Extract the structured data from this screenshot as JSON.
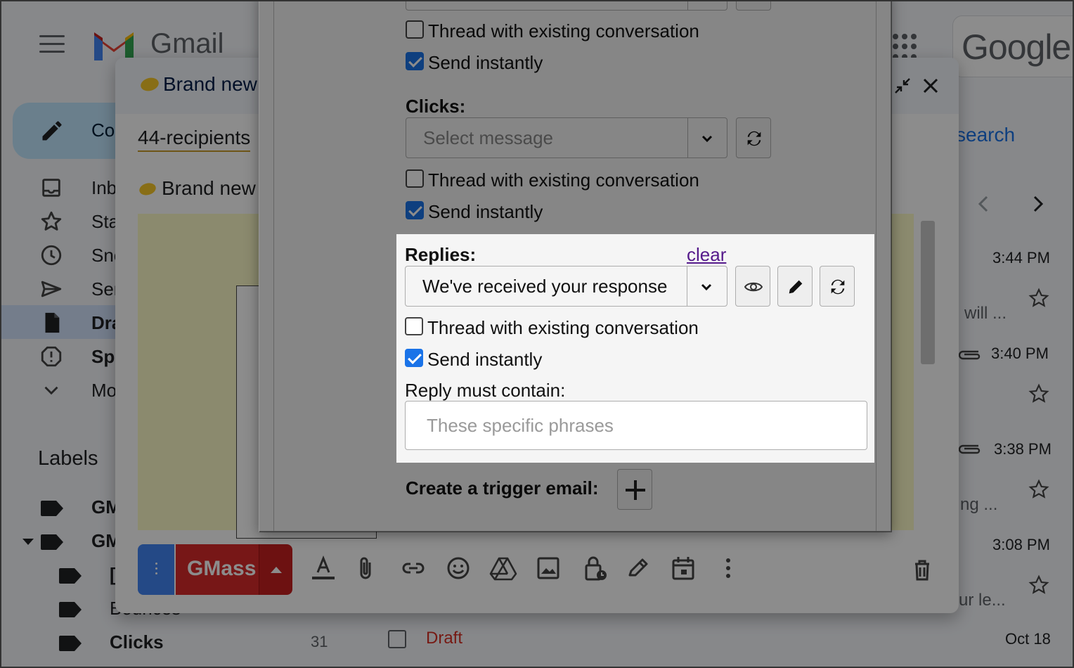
{
  "gmail": {
    "wordmark": "Gmail",
    "google_text": "Google",
    "compose_label": "Compose",
    "nav": [
      {
        "label": "Inbox",
        "icon": "inbox-icon"
      },
      {
        "label": "Starred",
        "icon": "star-icon"
      },
      {
        "label": "Snoozed",
        "icon": "clock-icon"
      },
      {
        "label": "Sent",
        "icon": "send-icon"
      },
      {
        "label": "Drafts",
        "icon": "draft-icon"
      },
      {
        "label": "Spam",
        "icon": "spam-icon"
      },
      {
        "label": "More",
        "icon": "chevron-down-icon"
      }
    ],
    "labels_heading": "Labels",
    "labels": [
      {
        "text": "GMass"
      },
      {
        "text": "GMass Reports"
      },
      {
        "text": "[..."
      },
      {
        "text": "Bounces"
      },
      {
        "text": "Clicks",
        "count": "31"
      }
    ],
    "search_link": "search",
    "mail_list": [
      {
        "time": "3:44 PM",
        "snippet": "will ..."
      },
      {
        "time": "3:40 PM",
        "snippet": ""
      },
      {
        "time": "3:38 PM",
        "snippet": "ng ..."
      },
      {
        "time": "3:08 PM",
        "snippet": "ur le..."
      }
    ],
    "draft_label": "Draft",
    "draft_date": "Oct 18"
  },
  "compose": {
    "title": "Brand new",
    "to": "44-recipients",
    "subject": "Brand new",
    "send_label": "GMass",
    "toolbar_icons": [
      "format-text-icon",
      "attach-icon",
      "link-icon",
      "emoji-icon",
      "drive-icon",
      "image-icon",
      "lock-clock-icon",
      "signature-icon",
      "schedule-icon",
      "more-vert-icon"
    ]
  },
  "panel": {
    "top_section": {
      "thread_label": "Thread with existing conversation",
      "send_label": "Send instantly",
      "thread_checked": false,
      "send_checked": true
    },
    "clicks": {
      "label": "Clicks:",
      "select_value": "Select message",
      "thread_label": "Thread with existing conversation",
      "send_label": "Send instantly",
      "thread_checked": false,
      "send_checked": true
    },
    "replies": {
      "label": "Replies:",
      "clear": "clear",
      "select_value": "We've received your response",
      "thread_label": "Thread with existing conversation",
      "send_label": "Send instantly",
      "thread_checked": false,
      "send_checked": true,
      "contain_label": "Reply must contain:",
      "contain_placeholder": "These specific phrases"
    },
    "trigger": {
      "label": "Create a trigger email:"
    }
  }
}
